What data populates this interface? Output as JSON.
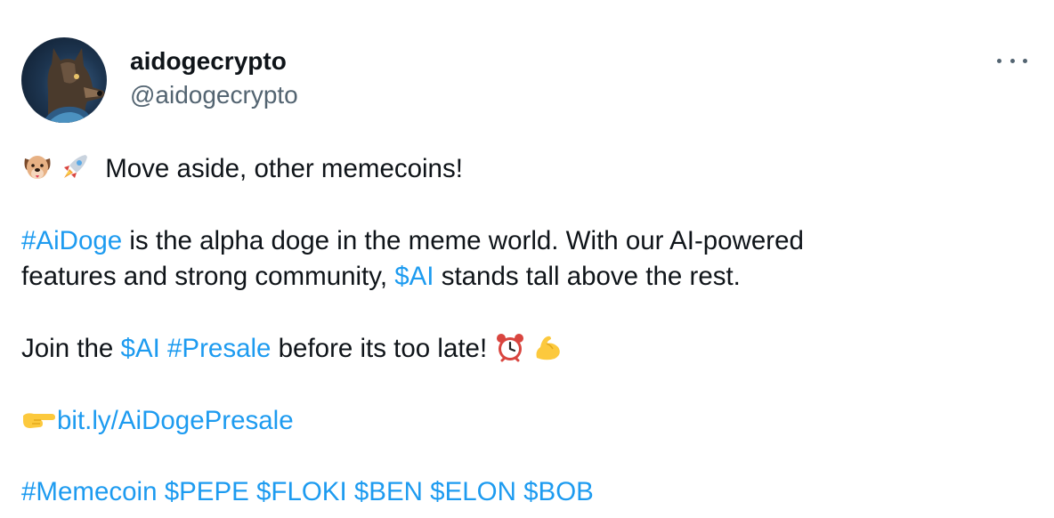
{
  "author": {
    "display_name": "aidogecrypto",
    "handle": "@aidogecrypto",
    "avatar_icon": "dog-avatar-icon"
  },
  "menu": {
    "more_icon": "more-options-icon"
  },
  "post": {
    "line1": {
      "emojis": [
        "dog-face-emoji",
        "rocket-emoji"
      ],
      "text": "Move aside, other memecoins!"
    },
    "para2": {
      "hashtag_aidoge": "#AiDoge",
      "text_a": " is the alpha doge in the meme world. With our AI-powered",
      "text_b": "features and strong community, ",
      "cashtag_ai": "$AI",
      "text_c": " stands tall above the rest."
    },
    "para3": {
      "text_a": "Join the ",
      "cashtag_ai": "$AI",
      "space": " ",
      "hashtag_presale": "#Presale",
      "text_b": " before its too late! ",
      "emojis": [
        "alarm-clock-emoji",
        "flexed-biceps-emoji"
      ]
    },
    "para4": {
      "emoji": "pointing-right-emoji",
      "link": "bit.ly/AiDogePresale"
    },
    "para5": {
      "hashtag_memecoin": "#Memecoin",
      "cashtag_pepe": "$PEPE",
      "cashtag_floki": "$FLOKI",
      "cashtag_ben": "$BEN",
      "cashtag_elon": "$ELON",
      "cashtag_bob": "$BOB"
    }
  },
  "colors": {
    "link": "#1d9bf0",
    "text": "#0f1419",
    "secondary": "#536471"
  }
}
